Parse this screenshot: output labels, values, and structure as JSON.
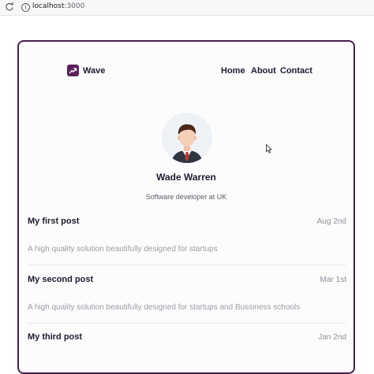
{
  "browser": {
    "url_host": "localhost",
    "url_port": ":3000"
  },
  "brand": {
    "name": "Wave",
    "accent": "#5b1f5c",
    "border": "#4a1d4f"
  },
  "nav": {
    "items": [
      "Home",
      "About",
      "Contact"
    ]
  },
  "profile": {
    "name": "Wade Warren",
    "role": "Software developer at UK"
  },
  "posts": [
    {
      "title": "My first post",
      "date": "Aug 2nd",
      "description": "A high quality solution beautifully designed for startups"
    },
    {
      "title": "My second post",
      "date": "Mar 1st",
      "description": "A high quality solution beautifully designed for startups and Bussiness schools"
    },
    {
      "title": "My third post",
      "date": "Jan 2nd",
      "description": ""
    }
  ]
}
